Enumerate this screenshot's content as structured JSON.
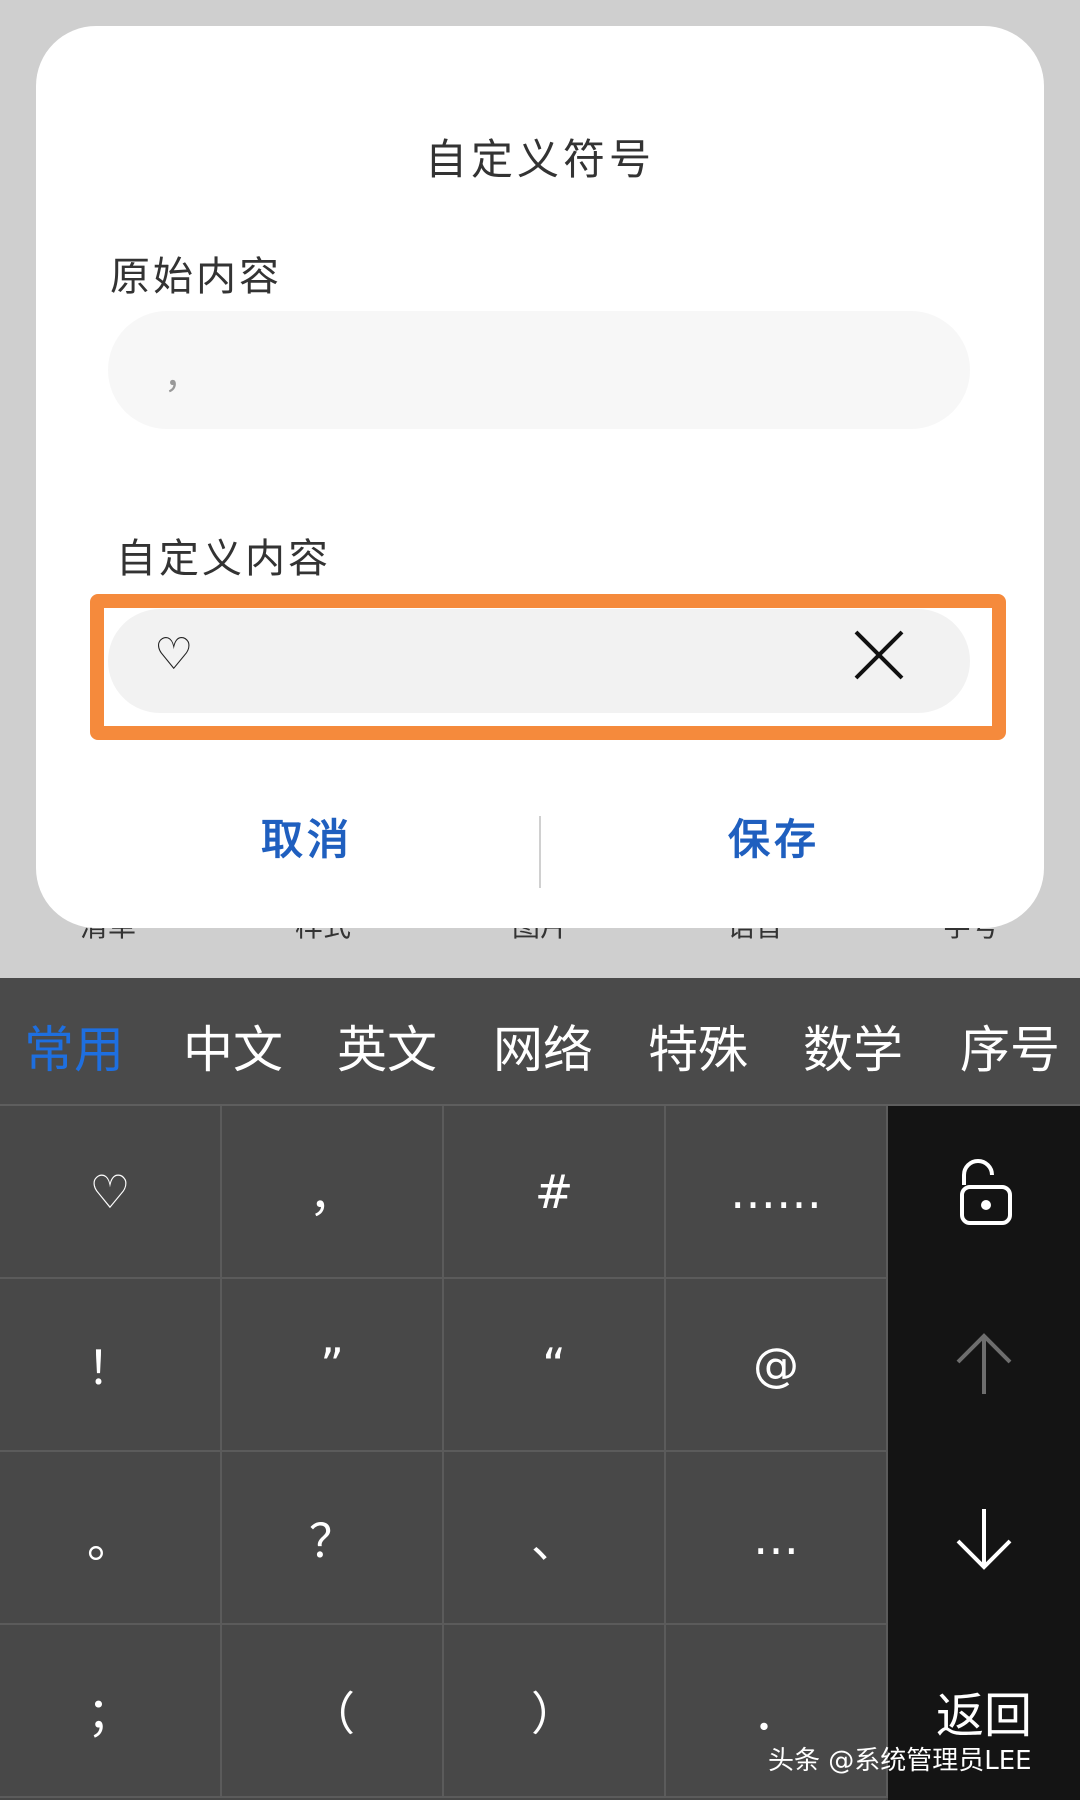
{
  "background_toolbar": {
    "items": [
      "清单",
      "样式",
      "图片",
      "语音",
      "字号"
    ]
  },
  "dialog": {
    "title": "自定义符号",
    "original_label": "原始内容",
    "original_value": "，",
    "custom_label": "自定义内容",
    "custom_value": "♡",
    "clear_icon": "close-icon",
    "cancel_label": "取消",
    "save_label": "保存",
    "highlight_color": "#f58a3c",
    "button_color": "#1f5fbf"
  },
  "keyboard": {
    "categories": [
      "常用",
      "中文",
      "英文",
      "网络",
      "特殊",
      "数学",
      "序号"
    ],
    "active_category": "常用",
    "active_color": "#1e6fe0",
    "keys": [
      [
        "♡",
        "，",
        "#",
        "……"
      ],
      [
        "！",
        "”",
        "“",
        "@"
      ],
      [
        "。",
        "？",
        "、",
        "…"
      ],
      [
        "；",
        "（",
        "）",
        "．"
      ]
    ],
    "side": {
      "lock_icon": "unlock-icon",
      "up_icon": "arrow-up-icon",
      "down_icon": "arrow-down-icon",
      "return_label": "返回"
    }
  },
  "watermark": "头条 @系统管理员LEE"
}
